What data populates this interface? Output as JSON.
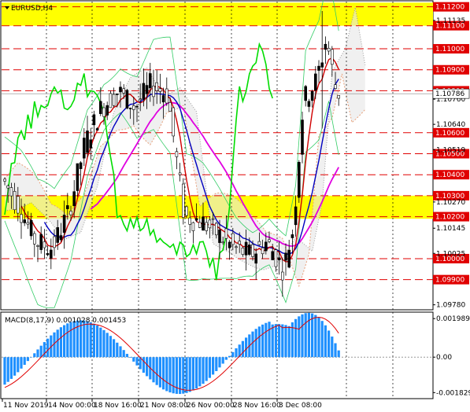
{
  "chart_data": [
    {
      "type": "candlestick",
      "symbol_label": "EURUSD,H4",
      "ylim": [
        1.0976,
        1.11225
      ],
      "y_ticks": [
        {
          "value": 1.11135,
          "text": "1.11135"
        },
        {
          "value": 1.1076,
          "text": "1.10760"
        },
        {
          "value": 1.1064,
          "text": "1.10640"
        },
        {
          "value": 1.10519,
          "text": "1.10519"
        },
        {
          "value": 1.1027,
          "text": "1.10270"
        },
        {
          "value": 1.10145,
          "text": "1.10145"
        },
        {
          "value": 1.10025,
          "text": "1.10025"
        },
        {
          "value": 1.0978,
          "text": "1.09780"
        }
      ],
      "levels": [
        {
          "value": 1.112,
          "text": "1.11200",
          "style": "yellow"
        },
        {
          "value": 1.1111,
          "text": "1.11100",
          "style": "red"
        },
        {
          "value": 1.11,
          "text": "1.11000",
          "style": "red"
        },
        {
          "value": 1.109,
          "text": "1.10900",
          "style": "red"
        },
        {
          "value": 1.108,
          "text": "1.10800",
          "style": "red"
        },
        {
          "value": 1.106,
          "text": "1.10600",
          "style": "red"
        },
        {
          "value": 1.105,
          "text": "1.10500",
          "style": "red"
        },
        {
          "value": 1.104,
          "text": "1.10400",
          "style": "red"
        },
        {
          "value": 1.103,
          "text": "1.10300",
          "style": "red"
        },
        {
          "value": 1.102,
          "text": "1.10200",
          "style": "red"
        },
        {
          "value": 1.1,
          "text": "1.10000",
          "style": "red"
        },
        {
          "value": 1.099,
          "text": "1.09900",
          "style": "red"
        }
      ],
      "current_price": {
        "value": 1.10786,
        "text": "1.10786"
      },
      "yellow_bands": [
        [
          1.1111,
          1.1122
        ],
        [
          1.1019,
          1.103
        ]
      ],
      "x_labels": [
        "11 Nov 2019",
        "14 Nov 00:00",
        "18 Nov 16:00",
        "21 Nov 08:00",
        "26 Nov 00:00",
        "28 Nov 16:00",
        "3 Dec 08:00"
      ],
      "series_colors": {
        "bull_body": "#000000",
        "bear_body": "#ffffff",
        "fast_ma": "#d00000",
        "mid_ma": "#0000c0",
        "slow_ma": "#e000e0",
        "bollinger": "#33cc66",
        "lagging": "#00dd00",
        "cloud_a": "#e8a07a",
        "cloud_b": "#999999"
      }
    },
    {
      "type": "histogram",
      "title": "MACD(8,17,9) 0.001028 0.001453",
      "ylim": [
        -0.0021,
        0.0022
      ],
      "y_ticks": [
        {
          "value": 0.001989,
          "text": "0.001989"
        },
        {
          "value": 0.0,
          "text": "0.00"
        },
        {
          "value": -0.001829,
          "text": "-0.001829"
        }
      ],
      "bar_color": "#1e90ff",
      "signal_color": "#e00000"
    }
  ]
}
